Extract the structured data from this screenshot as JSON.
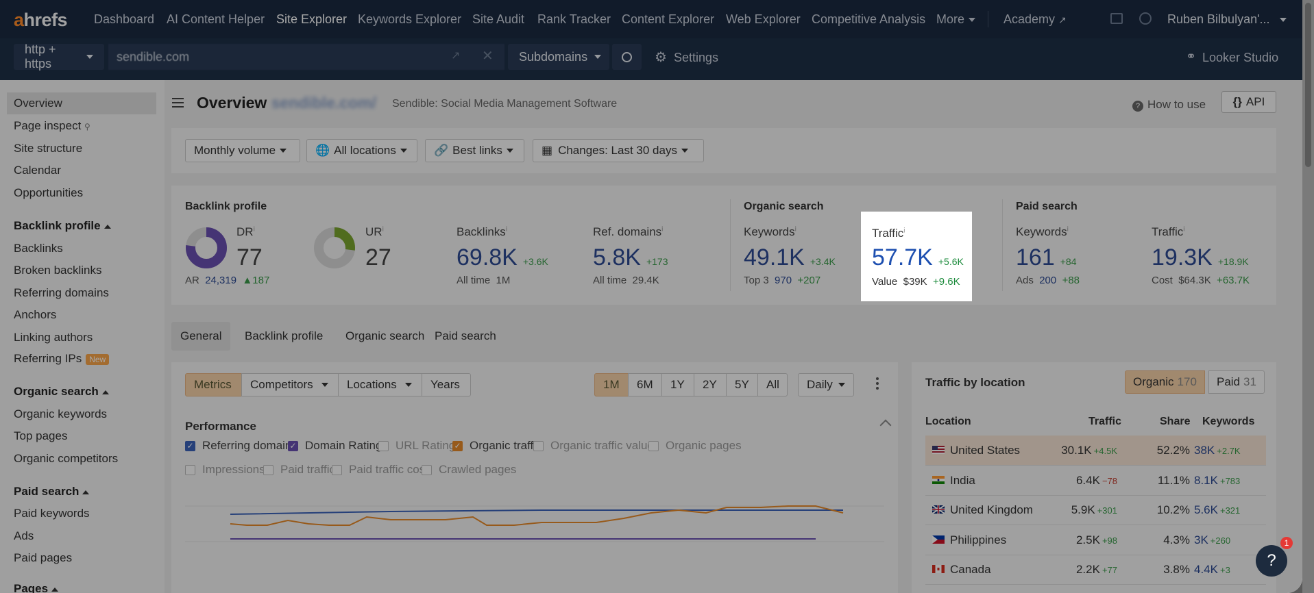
{
  "topnav": {
    "logo_a": "a",
    "logo_rest": "hrefs",
    "items": [
      "Dashboard",
      "AI Content Helper",
      "Site Explorer",
      "Keywords Explorer",
      "Site Audit",
      "Rank Tracker",
      "Content Explorer",
      "Web Explorer",
      "Competitive Analysis",
      "More"
    ],
    "academy": "Academy",
    "user": "Ruben Bilbulyan'..."
  },
  "subbar": {
    "protocol": "http + https",
    "url_value": "sendible.com",
    "mode": "Subdomains",
    "settings": "Settings",
    "looker": "Looker Studio"
  },
  "sidebar": {
    "overview": "Overview",
    "page_inspect": "Page inspect",
    "site_structure": "Site structure",
    "calendar": "Calendar",
    "opportunities": "Opportunities",
    "backlink_profile": "Backlink profile",
    "backlinks": "Backlinks",
    "broken_backlinks": "Broken backlinks",
    "referring_domains": "Referring domains",
    "anchors": "Anchors",
    "linking_authors": "Linking authors",
    "referring_ips": "Referring IPs",
    "new_badge": "New",
    "organic_search": "Organic search",
    "organic_keywords": "Organic keywords",
    "top_pages": "Top pages",
    "organic_competitors": "Organic competitors",
    "paid_search": "Paid search",
    "paid_keywords": "Paid keywords",
    "ads": "Ads",
    "paid_pages": "Paid pages",
    "pages": "Pages"
  },
  "header": {
    "title": "Overview",
    "domain": "sendible.com/",
    "subtitle": "Sendible: Social Media Management Software",
    "how_to_use": "How to use",
    "api": "API"
  },
  "filters": {
    "volume": "Monthly volume",
    "locations": "All locations",
    "links": "Best links",
    "changes": "Changes: Last 30 days"
  },
  "metrics": {
    "backlink_profile_head": "Backlink profile",
    "organic_head": "Organic search",
    "paid_head": "Paid search",
    "dr_label": "DR",
    "dr_value": "77",
    "ar_label": "AR",
    "ar_value": "24,319",
    "ar_delta": "187",
    "ur_label": "UR",
    "ur_value": "27",
    "backlinks_label": "Backlinks",
    "backlinks_value": "69.8K",
    "backlinks_delta": "+3.6K",
    "backlinks_sub_label": "All time",
    "backlinks_sub_value": "1M",
    "refdomains_label": "Ref. domains",
    "refdomains_value": "5.8K",
    "refdomains_delta": "+173",
    "refdomains_sub_label": "All time",
    "refdomains_sub_value": "29.4K",
    "org_kw_label": "Keywords",
    "org_kw_value": "49.1K",
    "org_kw_delta": "+3.4K",
    "org_kw_sub_label": "Top 3",
    "org_kw_sub_value": "970",
    "org_kw_sub_delta": "+207",
    "org_traffic_label": "Traffic",
    "org_traffic_value": "57.7K",
    "org_traffic_delta": "+5.6K",
    "org_traffic_sub_label": "Value",
    "org_traffic_sub_value": "$39K",
    "org_traffic_sub_delta": "+9.6K",
    "paid_kw_label": "Keywords",
    "paid_kw_value": "161",
    "paid_kw_delta": "+84",
    "paid_kw_sub_label": "Ads",
    "paid_kw_sub_value": "200",
    "paid_kw_sub_delta": "+88",
    "paid_traffic_label": "Traffic",
    "paid_traffic_value": "19.3K",
    "paid_traffic_delta": "+18.9K",
    "paid_traffic_sub_label": "Cost",
    "paid_traffic_sub_value": "$64.3K",
    "paid_traffic_sub_delta": "+63.7K",
    "dr_ring_fraction": 0.77,
    "ur_ring_fraction": 0.27
  },
  "tabs": [
    "General",
    "Backlink profile",
    "Organic search",
    "Paid search"
  ],
  "performance": {
    "toolbar": [
      "Metrics",
      "Competitors",
      "Locations",
      "Years"
    ],
    "ranges": [
      "1M",
      "6M",
      "1Y",
      "2Y",
      "5Y",
      "All"
    ],
    "interval": "Daily",
    "title": "Performance",
    "checkboxes": [
      {
        "label": "Referring domains",
        "checked": true,
        "color": "#3a62b8"
      },
      {
        "label": "Domain Rating",
        "checked": true,
        "color": "#6a4fb0"
      },
      {
        "label": "URL Rating",
        "checked": false
      },
      {
        "label": "Organic traffic",
        "checked": true,
        "color": "#e6892a"
      },
      {
        "label": "Organic traffic value",
        "checked": false
      },
      {
        "label": "Organic pages",
        "checked": false
      },
      {
        "label": "Impressions",
        "checked": false
      },
      {
        "label": "Paid traffic",
        "checked": false
      },
      {
        "label": "Paid traffic cost",
        "checked": false
      },
      {
        "label": "Crawled pages",
        "checked": false
      }
    ]
  },
  "traffic_by_location": {
    "title": "Traffic by location",
    "organic_label": "Organic",
    "organic_count": "170",
    "paid_label": "Paid",
    "paid_count": "31",
    "headers": [
      "Location",
      "Traffic",
      "Share",
      "Keywords"
    ],
    "rows": [
      {
        "country": "United States",
        "traffic": "30.1K",
        "traffic_delta": "+4.5K",
        "share": "52.2%",
        "keywords": "38K",
        "kw_delta": "+2.7K",
        "flag": "us"
      },
      {
        "country": "India",
        "traffic": "6.4K",
        "traffic_delta": "−78",
        "share": "11.1%",
        "keywords": "8.1K",
        "kw_delta": "+783",
        "flag": "in"
      },
      {
        "country": "United Kingdom",
        "traffic": "5.9K",
        "traffic_delta": "+301",
        "share": "10.2%",
        "keywords": "5.6K",
        "kw_delta": "+321",
        "flag": "gb"
      },
      {
        "country": "Philippines",
        "traffic": "2.5K",
        "traffic_delta": "+98",
        "share": "4.3%",
        "keywords": "3K",
        "kw_delta": "+260",
        "flag": "ph"
      },
      {
        "country": "Canada",
        "traffic": "2.2K",
        "traffic_delta": "+77",
        "share": "3.8%",
        "keywords": "4.4K",
        "kw_delta": "+3",
        "flag": "ca"
      }
    ]
  },
  "help": {
    "label": "?",
    "notification_count": "1"
  }
}
